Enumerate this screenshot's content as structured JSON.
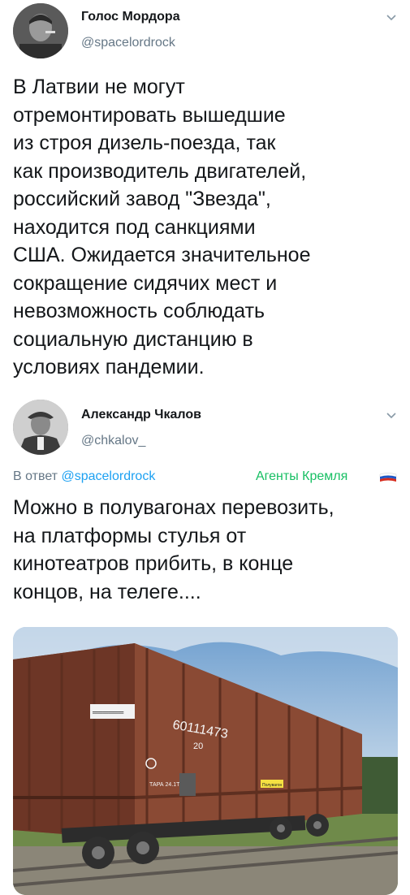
{
  "tweet1": {
    "display_name": "Голос Мордора",
    "handle": "@spacelordrock",
    "lines": [
      "В Латвии не могут",
      "отремонтировать вышедшие",
      "из строя дизель-поезда, так",
      "как производитель двигателей,",
      "российский завод \"Звезда\",",
      "находится под санкциями",
      "США. Ожидается значительное",
      "сокращение сидячих мест и",
      "невозможность соблюдать",
      "социальную дистанцию в",
      "условиях пандемии."
    ]
  },
  "tweet2": {
    "display_name": "Александр Чкалов",
    "handle": "@chkalov_",
    "reply_prefix": "В ответ",
    "reply_to": "@spacelordrock",
    "badge": "Агенты Кремля",
    "lines": [
      "Можно в полувагонах перевозить,",
      "на платформы стулья от",
      "кинотеатров прибить, в конце",
      "концов, на телеге...."
    ],
    "media": {
      "wagon_text": "60111473",
      "wagon_small": "20",
      "wagon_tag": "ТАРА 24.1Т",
      "wagon_plate": "Полувагон"
    }
  },
  "icons": {
    "chevron": "chevron-down-icon",
    "flag": "russia-flag-icon"
  },
  "colors": {
    "handle": "#657786",
    "mention": "#1da1f2",
    "badge": "#17bf63",
    "wagon": "#8a4a34"
  }
}
